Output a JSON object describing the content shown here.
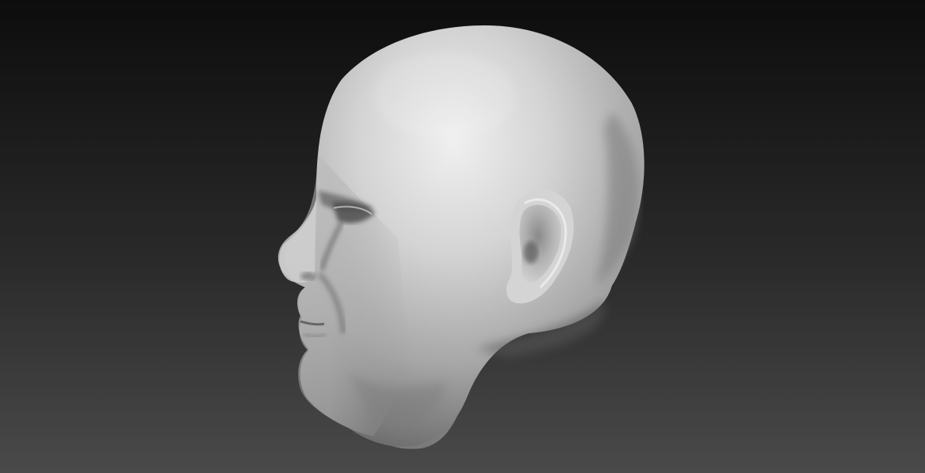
{
  "scene": {
    "subject": "sculpted-head-profile-icon",
    "background_top": "#0d0d0d",
    "background_bottom": "#4a4a4a",
    "material_highlight": "#f2f2f2",
    "material_mid": "#bdbdbd",
    "material_shadow": "#6f6f6f"
  }
}
